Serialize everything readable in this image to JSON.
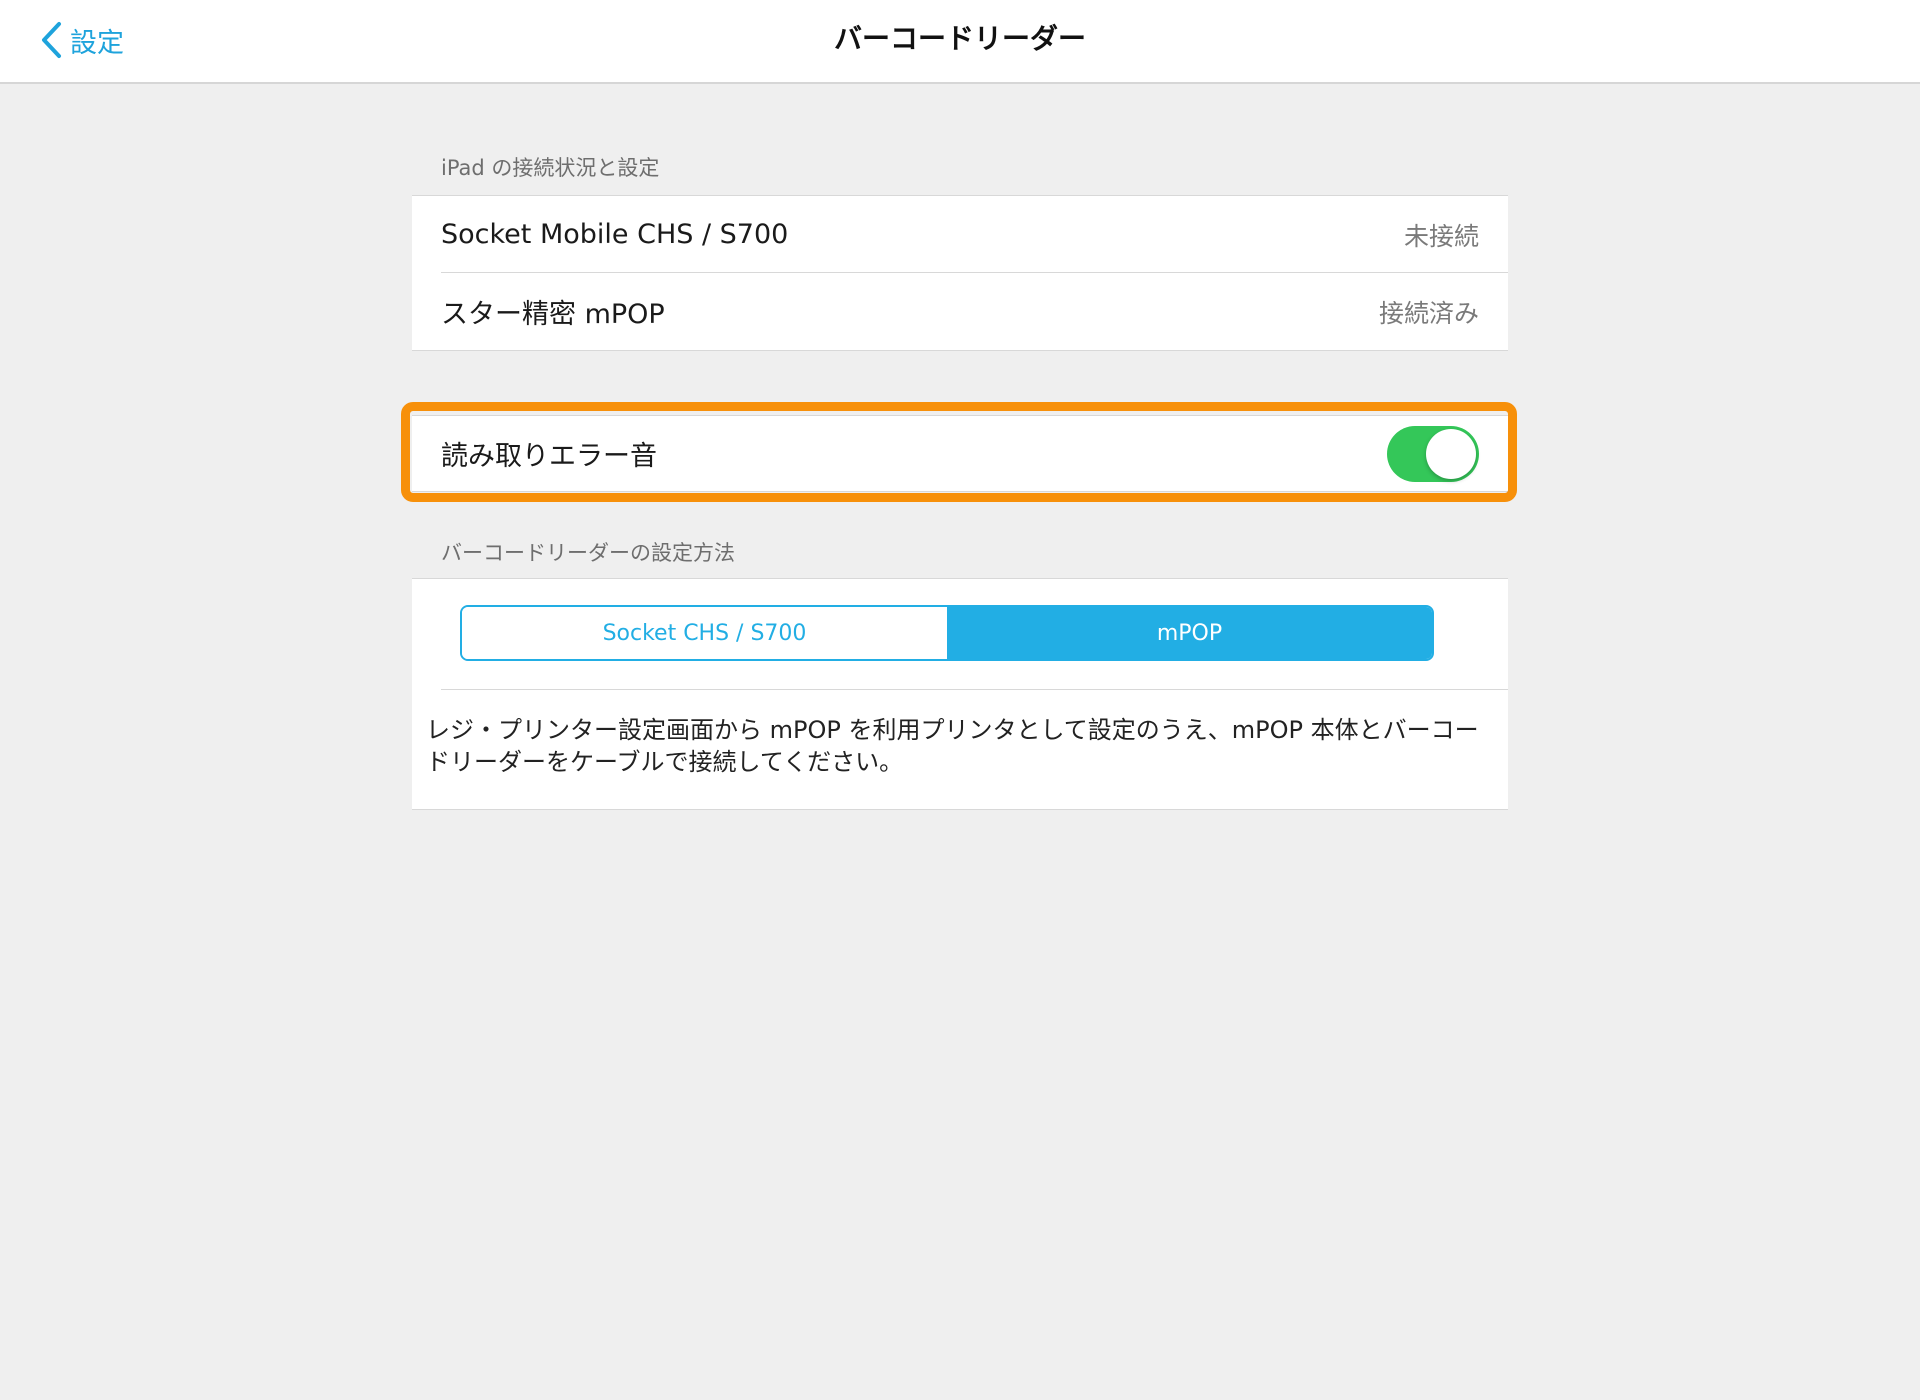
{
  "navbar": {
    "back_label": "設定",
    "title": "バーコードリーダー"
  },
  "connection_section": {
    "header": "iPad の接続状況と設定",
    "rows": [
      {
        "label": "Socket Mobile CHS / S700",
        "status": "未接続"
      },
      {
        "label": "スター精密 mPOP",
        "status": "接続済み"
      }
    ]
  },
  "error_sound": {
    "label": "読み取りエラー音",
    "enabled": true,
    "toggle_color": "#34c759",
    "highlight_color": "#f7900a"
  },
  "setup_section": {
    "header": "バーコードリーダーの設定方法",
    "segments": [
      {
        "label": "Socket CHS / S700",
        "selected": false
      },
      {
        "label": "mPOP",
        "selected": true
      }
    ],
    "accent_color": "#22aee4",
    "description": "レジ・プリンター設定画面から mPOP を利用プリンタとして設定のうえ、mPOP 本体とバーコードリーダーをケーブルで接続してください。"
  },
  "icons": {
    "back": "chevron-left-icon"
  }
}
